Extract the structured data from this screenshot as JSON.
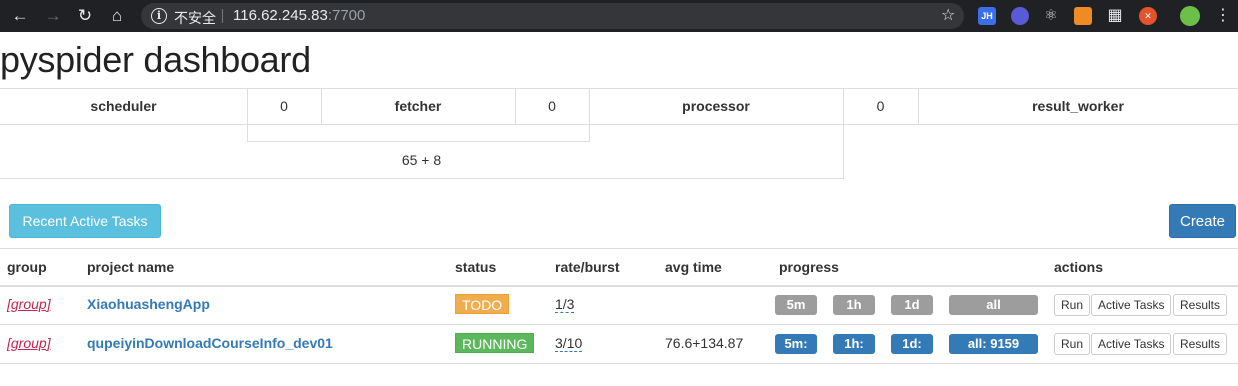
{
  "browser": {
    "security_text": "不安全",
    "host": "116.62.245.83",
    "port": ":7700",
    "extensions": [
      {
        "icon": "jh-extension-icon",
        "label": "JH",
        "color": "#3b6ee8"
      },
      {
        "icon": "vpn-extension-icon",
        "label": "",
        "color": "#5a5ad6"
      },
      {
        "icon": "react-extension-icon",
        "label": "⚛",
        "color": "#202124"
      },
      {
        "icon": "orange-extension-icon",
        "label": "",
        "color": "#f08a24"
      },
      {
        "icon": "qr-extension-icon",
        "label": "▦",
        "color": "#202124"
      },
      {
        "icon": "red-extension-icon",
        "label": "✕",
        "color": "#e3542c"
      }
    ]
  },
  "page": {
    "title": "pyspider dashboard"
  },
  "stats": {
    "scheduler_label": "scheduler",
    "scheduler_value": "0",
    "fetcher_label": "fetcher",
    "fetcher_value": "0",
    "processor_label": "processor",
    "processor_value": "0",
    "result_worker_label": "result_worker",
    "queue_text": "65 + 8"
  },
  "buttons": {
    "recent_active_tasks": "Recent Active Tasks",
    "create": "Create"
  },
  "table": {
    "headers": {
      "group": "group",
      "project_name": "project name",
      "status": "status",
      "rate_burst": "rate/burst",
      "avg_time": "avg time",
      "progress": "progress",
      "actions": "actions"
    },
    "rows": [
      {
        "group": "[group]",
        "project_name": "XiaohuashengApp",
        "status": "TODO",
        "rate_burst": "1/3",
        "avg_time": "",
        "progress": {
          "m5": "5m",
          "h1": "1h",
          "d1": "1d",
          "all": "all"
        },
        "actions": {
          "run": "Run",
          "active_tasks": "Active Tasks",
          "results": "Results"
        }
      },
      {
        "group": "[group]",
        "project_name": "qupeiyinDownloadCourseInfo_dev01",
        "status": "RUNNING",
        "rate_burst": "3/10",
        "avg_time": "76.6+134.87",
        "progress": {
          "m5": "5m:",
          "h1": "1h:",
          "d1": "1d:",
          "all": "all: 9159"
        },
        "actions": {
          "run": "Run",
          "active_tasks": "Active Tasks",
          "results": "Results"
        }
      }
    ]
  },
  "colors": {
    "link": "#337ab7",
    "group": "#c7254e",
    "todo": "#f0ad4e",
    "running": "#5cb85c",
    "info_button": "#5bc0de",
    "primary_button": "#337ab7",
    "progress_idle": "#9d9d9d",
    "progress_active": "#337ab7"
  }
}
